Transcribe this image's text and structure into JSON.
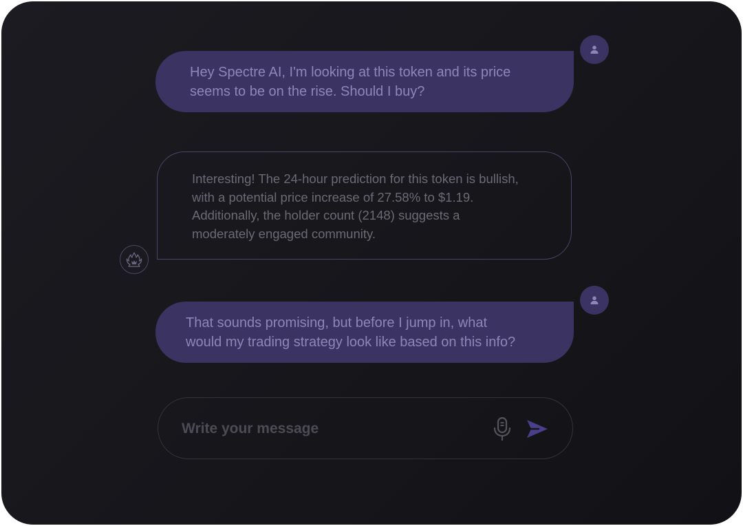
{
  "chat": {
    "messages": [
      {
        "role": "user",
        "text": "Hey Spectre AI, I'm looking at this token and its price\nseems to be on the rise. Should I buy?"
      },
      {
        "role": "assistant",
        "text": "Interesting! The 24-hour prediction for this token is bullish,\nwith a potential price increase of 27.58% to $1.19.\nAdditionally, the holder count (2148) suggests a\nmoderately engaged community."
      },
      {
        "role": "user",
        "text": "That sounds promising, but before I jump in, what\nwould my trading strategy look like based on this info?"
      }
    ]
  },
  "composer": {
    "placeholder": "Write your message",
    "value": ""
  },
  "icons": {
    "user_avatar": "user-icon",
    "assistant_avatar": "spectre-flame-logo-icon",
    "mic": "microphone-icon",
    "send": "send-icon"
  },
  "colors": {
    "user_bubble": "#3b3462",
    "user_text": "#8f86b8",
    "assistant_border": "#4a4568",
    "assistant_text": "#6c6a76",
    "accent": "#4a3f8a"
  }
}
